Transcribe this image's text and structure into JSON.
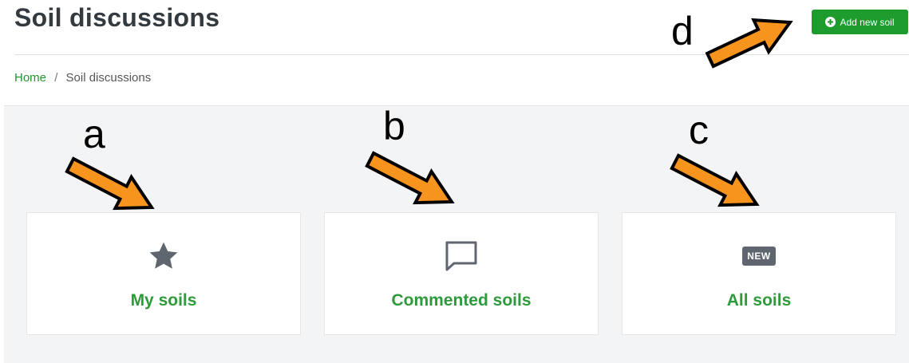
{
  "header": {
    "title": "Soil discussions",
    "add_button_label": "Add new soil",
    "add_button_icon": "plus-circle-icon"
  },
  "breadcrumb": {
    "home": "Home",
    "separator": "/",
    "current": "Soil discussions"
  },
  "cards": [
    {
      "label": "My soils",
      "icon": "star-icon"
    },
    {
      "label": "Commented soils",
      "icon": "comment-icon"
    },
    {
      "label": "All soils",
      "icon": "new-badge-icon",
      "badge_text": "NEW"
    }
  ],
  "annotations": [
    "a",
    "b",
    "c",
    "d"
  ],
  "colors": {
    "accent_green": "#1e9b2d",
    "label_green": "#2e9a3c",
    "arrow_fill": "#f7941d",
    "icon_gray": "#5f6670",
    "content_bg": "#f3f4f6"
  }
}
